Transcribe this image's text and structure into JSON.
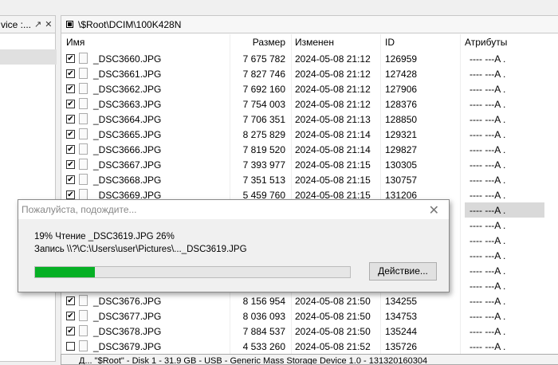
{
  "left_panel": {
    "title": "vice :...",
    "pin_icon": "↗",
    "close_icon": "✕"
  },
  "path": "\\$Root\\DCIM\\100K428N",
  "columns": {
    "name": "Имя",
    "size": "Размер",
    "modified": "Изменен",
    "id": "ID",
    "attributes": "Атрибуты"
  },
  "rows": [
    {
      "checked": true,
      "name": "_DSC3660.JPG",
      "size": "7 675 782",
      "date": "2024-05-08 21:12",
      "id": "126959",
      "attr": "---- ---A ."
    },
    {
      "checked": true,
      "name": "_DSC3661.JPG",
      "size": "7 827 746",
      "date": "2024-05-08 21:12",
      "id": "127428",
      "attr": "---- ---A ."
    },
    {
      "checked": true,
      "name": "_DSC3662.JPG",
      "size": "7 692 160",
      "date": "2024-05-08 21:12",
      "id": "127906",
      "attr": "---- ---A ."
    },
    {
      "checked": true,
      "name": "_DSC3663.JPG",
      "size": "7 754 003",
      "date": "2024-05-08 21:12",
      "id": "128376",
      "attr": "---- ---A ."
    },
    {
      "checked": true,
      "name": "_DSC3664.JPG",
      "size": "7 706 351",
      "date": "2024-05-08 21:13",
      "id": "128850",
      "attr": "---- ---A ."
    },
    {
      "checked": true,
      "name": "_DSC3665.JPG",
      "size": "8 275 829",
      "date": "2024-05-08 21:14",
      "id": "129321",
      "attr": "---- ---A ."
    },
    {
      "checked": true,
      "name": "_DSC3666.JPG",
      "size": "7 819 520",
      "date": "2024-05-08 21:14",
      "id": "129827",
      "attr": "---- ---A ."
    },
    {
      "checked": true,
      "name": "_DSC3667.JPG",
      "size": "7 393 977",
      "date": "2024-05-08 21:15",
      "id": "130305",
      "attr": "---- ---A ."
    },
    {
      "checked": true,
      "name": "_DSC3668.JPG",
      "size": "7 351 513",
      "date": "2024-05-08 21:15",
      "id": "130757",
      "attr": "---- ---A ."
    },
    {
      "checked": true,
      "name": "_DSC3669.JPG",
      "size": "5 459 760",
      "date": "2024-05-08 21:15",
      "id": "131206",
      "attr": "---- ---A ."
    },
    {
      "attr": "---- ---A .",
      "highlight": true
    },
    {
      "attr": "---- ---A ."
    },
    {
      "attr": "---- ---A ."
    },
    {
      "attr": "---- ---A ."
    },
    {
      "attr": "---- ---A ."
    },
    {
      "attr": "---- ---A ."
    },
    {
      "checked": true,
      "name": "_DSC3676.JPG",
      "size": "8 156 954",
      "date": "2024-05-08 21:50",
      "id": "134255",
      "attr": "---- ---A ."
    },
    {
      "checked": true,
      "name": "_DSC3677.JPG",
      "size": "8 036 093",
      "date": "2024-05-08 21:50",
      "id": "134753",
      "attr": "---- ---A ."
    },
    {
      "checked": true,
      "name": "_DSC3678.JPG",
      "size": "7 884 537",
      "date": "2024-05-08 21:50",
      "id": "135244",
      "attr": "---- ---A ."
    },
    {
      "checked": false,
      "name": "_DSC3679.JPG",
      "size": "4 533 260",
      "date": "2024-05-08 21:52",
      "id": "135726",
      "attr": "---- ---A ."
    }
  ],
  "status": "Д... \"$Root\" - Disk 1 - 31.9 GB - USB - Generic Mass Storage Device 1.0 - 131320160304",
  "dialog": {
    "title": "Пожалуйста, подождите...",
    "line1": "19% Чтение _DSC3619.JPG 26%",
    "line2": "Запись \\\\?\\C:\\Users\\user\\Pictures\\..._DSC3619.JPG",
    "progress_percent": 19,
    "progress_color": "#06b025",
    "action_button": "Действие..."
  }
}
